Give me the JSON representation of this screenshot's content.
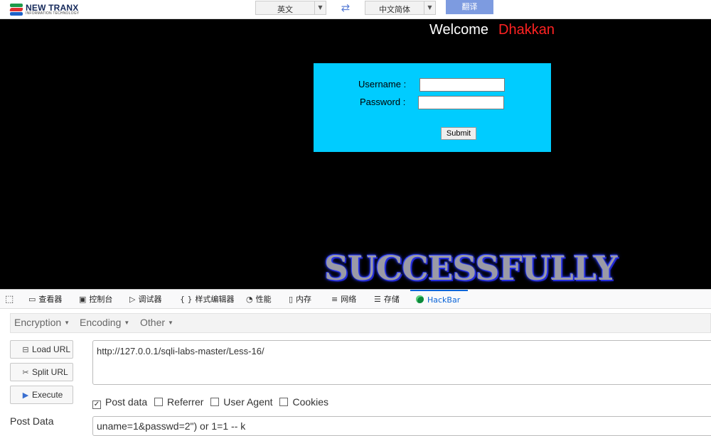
{
  "translator": {
    "logo_name": "NEW TRANX",
    "logo_tagline": "INFORMATION TECHNOLOGY",
    "source_lang": "英文",
    "target_lang": "中文简体",
    "translate_label": "翻译"
  },
  "page": {
    "welcome": "Welcome",
    "user": "Dhakkan",
    "username_label": "Username :",
    "password_label": "Password :",
    "submit_label": "Submit",
    "banner": "SUCCESSFULLY"
  },
  "devtools": {
    "tabs": [
      {
        "label": "查看器",
        "icon": "inspector-icon"
      },
      {
        "label": "控制台",
        "icon": "console-icon"
      },
      {
        "label": "调试器",
        "icon": "debugger-icon"
      },
      {
        "label": "样式编辑器",
        "icon": "style-editor-icon"
      },
      {
        "label": "性能",
        "icon": "performance-icon"
      },
      {
        "label": "内存",
        "icon": "memory-icon"
      },
      {
        "label": "网络",
        "icon": "network-icon"
      },
      {
        "label": "存储",
        "icon": "storage-icon"
      },
      {
        "label": "HackBar",
        "icon": "hackbar-icon",
        "active": true
      }
    ]
  },
  "hackbar": {
    "menus": [
      "Encryption",
      "Encoding",
      "Other"
    ],
    "load_url": "Load URL",
    "split_url": "Split URL",
    "execute": "Execute",
    "url_value": "http://127.0.0.1/sqli-labs-master/Less-16/",
    "options": {
      "post_data": {
        "label": "Post data",
        "checked": true
      },
      "referrer": {
        "label": "Referrer",
        "checked": false
      },
      "user_agent": {
        "label": "User Agent",
        "checked": false
      },
      "cookies": {
        "label": "Cookies",
        "checked": false
      }
    },
    "post_data_label": "Post Data",
    "post_data_value": "uname=1&passwd=2\") or 1=1 -- k"
  },
  "colors": {
    "login_bg": "#00ccff",
    "user_name": "#ff2222",
    "active_tab": "#0a64d8"
  }
}
